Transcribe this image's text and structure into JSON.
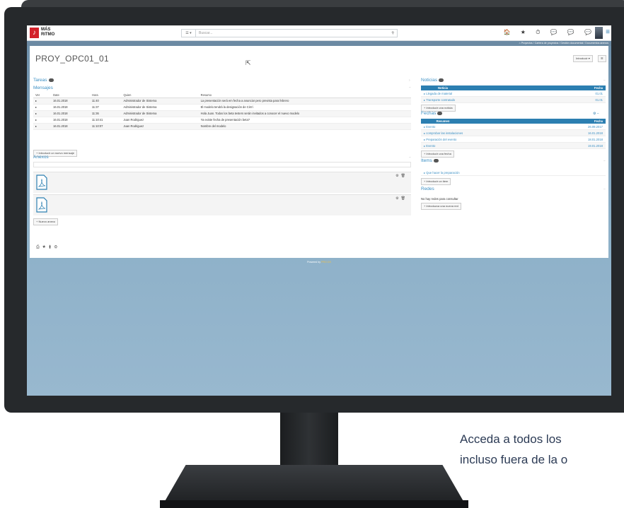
{
  "app": {
    "logo_line1": "MÁS",
    "logo_line2": "RITMO",
    "logo_glyph": "♪"
  },
  "search": {
    "selector": "☰ ▾",
    "placeholder": "Buscar...",
    "icon": "search-icon"
  },
  "toolbar": {
    "icons": "🏠 ★ ⏱ 💬 💬 💬"
  },
  "breadcrumb": "⌂  Proyectos / Cartera de proyectos / Gestión documental / Documentos anexos",
  "page": {
    "title": "PROY_OPC01_01",
    "intro_button": "Introducir ▾",
    "menu_button": "☰"
  },
  "tareas": {
    "label": "Tareas"
  },
  "mensajes": {
    "label": "Mensajes",
    "columns": [
      "Ver",
      "Date",
      "Hora",
      "Quien",
      "Resumo"
    ],
    "rows": [
      {
        "date": "16.01.2018",
        "hora": "11:40",
        "quien": "Administrador de Sistema",
        "resumo": "La presentación será em fecha a anunciar pero prevista para febrero"
      },
      {
        "date": "16.01.2018",
        "hora": "11:37",
        "quien": "Administrador de Sistema",
        "resumo": "El modelo tendrá la designación de Cirrri"
      },
      {
        "date": "16.01.2018",
        "hora": "11:36",
        "quien": "Administrador de Sistema",
        "resumo": "Hola Juan. Todos los beta testers serán invitados a conocer el nuevo modelo"
      },
      {
        "date": "16.01.2018",
        "hora": "11:10:41",
        "quien": "Juan Rodriguez",
        "resumo": "Ya existe fecha de presentación beta?"
      },
      {
        "date": "16.01.2018",
        "hora": "11:10:07",
        "quien": "Juan Rodriguez",
        "resumo": "Nombre del modelo"
      }
    ],
    "add_button": "+ Introducir un nuevo mensaje"
  },
  "anexos": {
    "label": "Anexos",
    "add_button": "+ Nuevo anexo"
  },
  "noticias": {
    "label": "Noticias",
    "columns": [
      "Noticia",
      "Fecha"
    ],
    "rows": [
      {
        "name": "Llegada de material",
        "date": "01.01"
      },
      {
        "name": "Transporte contratado",
        "date": "01.01"
      }
    ],
    "add_button": "+ Introducir una noticia"
  },
  "fechas": {
    "label": "Fechas",
    "columns": [
      "Resumen",
      "Fecha"
    ],
    "rows": [
      {
        "name": "Evento",
        "date": "26.09.2017"
      },
      {
        "name": "comprobar las instalaciones",
        "date": "16.01.2018"
      },
      {
        "name": "Preparación del evento",
        "date": "18.01.2018"
      },
      {
        "name": "Evento",
        "date": "19.01.2018"
      }
    ],
    "add_button": "+ Introducir una fecha"
  },
  "items": {
    "label": "Items",
    "rows": [
      "Que hacer la preparación"
    ],
    "add_button": "+ Introducir un item"
  },
  "redes": {
    "label": "Redes",
    "empty": "No hay redes para consultar",
    "add_button": "+ Introduzca una nueva red"
  },
  "footer": {
    "text": "Powered by",
    "brand": "PRO DS"
  },
  "caption": {
    "line1": "Acceda a todos los",
    "line2": "incluso fuera de la o"
  }
}
